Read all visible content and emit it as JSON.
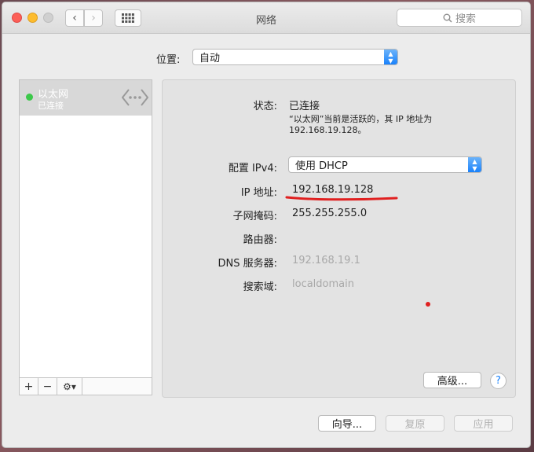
{
  "window": {
    "title": "网络"
  },
  "search": {
    "placeholder": "搜索"
  },
  "location": {
    "label": "位置:",
    "value": "自动"
  },
  "sidebar": {
    "items": [
      {
        "name": "以太网",
        "status": "已连接",
        "status_color": "#3cc84a"
      }
    ],
    "toolbar": {
      "add": "+",
      "remove": "−",
      "gear": "⚙▾"
    }
  },
  "panel": {
    "status_label": "状态:",
    "status_value": "已连接",
    "status_desc": "“以太网”当前是活跃的，其 IP 地址为 192.168.19.128。",
    "ipv4_label": "配置 IPv4:",
    "ipv4_value": "使用 DHCP",
    "ip_label": "IP 地址:",
    "ip_value": "192.168.19.128",
    "subnet_label": "子网掩码:",
    "subnet_value": "255.255.255.0",
    "router_label": "路由器:",
    "router_value": "",
    "dns_label": "DNS 服务器:",
    "dns_value": "192.168.19.1",
    "search_domain_label": "搜索域:",
    "search_domain_value": "localdomain",
    "advanced_button": "高级...",
    "help_button": "?"
  },
  "footer": {
    "assist_button": "向导...",
    "revert_button": "复原",
    "apply_button": "应用"
  },
  "colors": {
    "accent": "#1a82fb",
    "annotation": "#e02020"
  }
}
